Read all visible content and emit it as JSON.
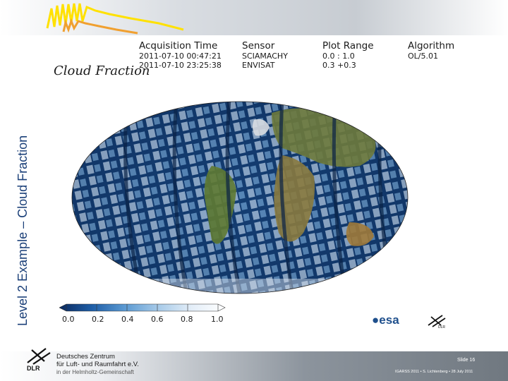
{
  "slide": {
    "vertical_title": "Level 2 Example – Cloud Fraction",
    "plot_title": "Cloud Fraction",
    "header": [
      {
        "label": "Acquisition Time",
        "values": [
          "2011-07-10 00:47:21",
          "2011-07-10 23:25:38"
        ]
      },
      {
        "label": "Sensor",
        "values": [
          "SCIAMACHY",
          "ENVISAT"
        ]
      },
      {
        "label": "Plot Range",
        "values": [
          "0.0 :  1.0",
          "0.3 +0.3"
        ]
      },
      {
        "label": "Algorithm",
        "values": [
          "OL/5.01",
          ""
        ]
      }
    ],
    "colorbar_ticks": [
      "0.0",
      "0.2",
      "0.4",
      "0.6",
      "0.8",
      "1.0"
    ],
    "colorbar_colors": [
      "#0b2a5e",
      "#1f5fa8",
      "#5d9bd3",
      "#a8cbe9",
      "#e4eef8",
      "#ffffff"
    ],
    "logos": {
      "esa": "esa",
      "dlr_small": "DLR"
    },
    "footer": {
      "org_line1": "Deutsches Zentrum",
      "org_line2": "für Luft- und Raumfahrt e.V.",
      "org_line3": "in der Helmholtz-Gemeinschaft",
      "dlr": "DLR",
      "slide_number": "Slide 16",
      "note": "IGARSS 2011 • S. Lichtenberg • 28 July 2011"
    }
  }
}
